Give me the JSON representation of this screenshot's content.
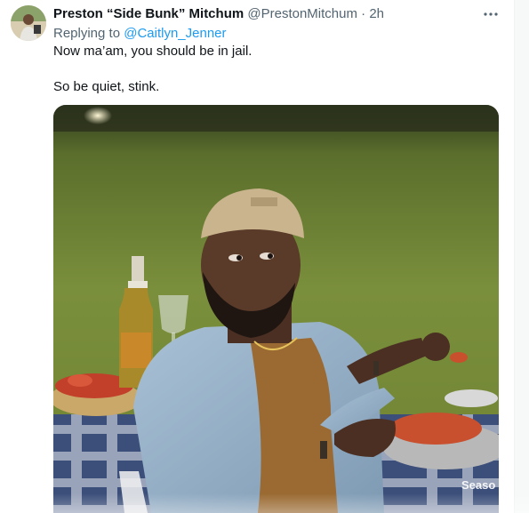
{
  "tweet": {
    "author": {
      "display_name": "Preston “Side Bunk” Mitchum",
      "handle": "@PrestonMitchum",
      "avatar_icon": "profile-avatar"
    },
    "separator": "·",
    "time": "2h",
    "more_icon": "more-horizontal-icon",
    "reply": {
      "prefix": "Replying to",
      "mention": "@Caitlyn_Jenner"
    },
    "text_lines": [
      "Now ma’am, you should be in jail.",
      "So be quiet, stink."
    ],
    "media": {
      "type": "image",
      "watermark": "Seaso"
    }
  },
  "colors": {
    "text_primary": "#0f1419",
    "text_secondary": "#536471",
    "link": "#1d9bf0"
  }
}
